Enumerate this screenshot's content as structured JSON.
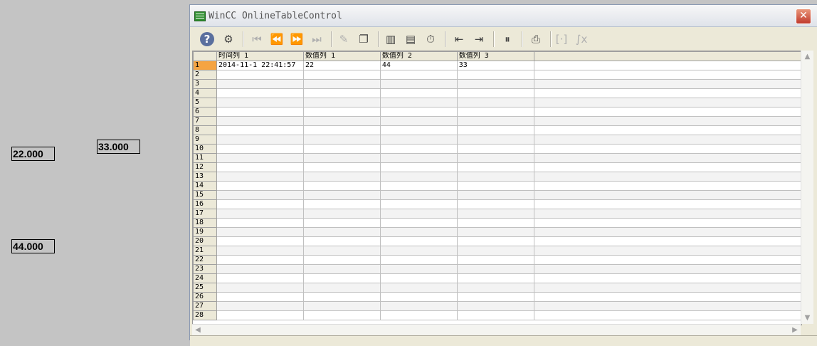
{
  "io_fields": [
    {
      "value": "22.000"
    },
    {
      "value": "33.000"
    },
    {
      "value": "44.000"
    }
  ],
  "window": {
    "title": "WinCC OnlineTableControl",
    "close_glyph": "✕"
  },
  "toolbar": {
    "buttons": [
      {
        "name": "help-icon",
        "glyph": "?",
        "enabled": true
      },
      {
        "name": "config-dialog-icon",
        "glyph": "⚙",
        "enabled": true
      },
      {
        "name": "first-record-icon",
        "glyph": "⏮",
        "enabled": false
      },
      {
        "name": "previous-record-icon",
        "glyph": "⏪",
        "enabled": false
      },
      {
        "name": "next-record-icon",
        "glyph": "⏩",
        "enabled": false
      },
      {
        "name": "last-record-icon",
        "glyph": "⏭",
        "enabled": false
      },
      {
        "name": "edit-icon",
        "glyph": "✎",
        "enabled": false
      },
      {
        "name": "copy-rows-icon",
        "glyph": "❐",
        "enabled": true
      },
      {
        "name": "select-data-connection-icon",
        "glyph": "▥",
        "enabled": true
      },
      {
        "name": "select-columns-icon",
        "glyph": "▤",
        "enabled": true
      },
      {
        "name": "time-range-icon",
        "glyph": "⏱",
        "enabled": true
      },
      {
        "name": "previous-column-icon",
        "glyph": "⇤",
        "enabled": true
      },
      {
        "name": "next-column-icon",
        "glyph": "⇥",
        "enabled": true
      },
      {
        "name": "stop-icon",
        "glyph": "⏸",
        "enabled": true
      },
      {
        "name": "print-icon",
        "glyph": "⎙",
        "enabled": true
      },
      {
        "name": "define-statistics-area-icon",
        "glyph": "[·]",
        "enabled": false
      },
      {
        "name": "statistics-icon",
        "glyph": "∫x",
        "enabled": false
      }
    ]
  },
  "table": {
    "columns": [
      "时间列 1",
      "数值列 1",
      "数值列 2",
      "数值列 3"
    ],
    "rows": [
      [
        "2014-11-1 22:41:57",
        "22",
        "44",
        "33"
      ]
    ],
    "row_numbers": [
      "1",
      "2",
      "3",
      "4",
      "5",
      "6",
      "7",
      "8",
      "9",
      "10",
      "11",
      "12",
      "13",
      "14",
      "15",
      "16",
      "17",
      "18",
      "19",
      "20",
      "21",
      "22",
      "23",
      "24",
      "25",
      "26",
      "27",
      "28"
    ]
  },
  "colors": {
    "selected_row_header": "#f5a442",
    "background": "#c4c4c4"
  }
}
